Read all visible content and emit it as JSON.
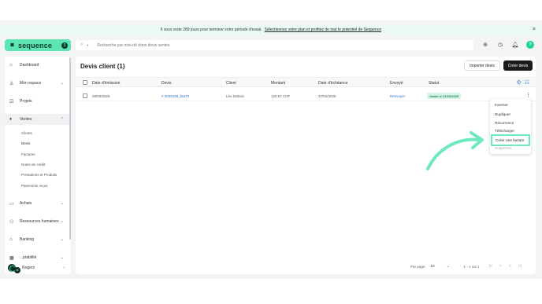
{
  "banner": {
    "text": "Il vous reste 289 jours pour terminer votre période d'essai.",
    "link": "Sélectionnez votre plan et profitez de tout le potentiel de Sequence",
    "close": "×"
  },
  "brand": {
    "name": "sequence",
    "badge": "$"
  },
  "search": {
    "placeholder": "Recherche par mot-clé dans devis ventes"
  },
  "sidebar": {
    "items": [
      {
        "label": "Dashboard",
        "icon": "home-icon"
      },
      {
        "label": "Mon espace",
        "icon": "person-icon"
      },
      {
        "label": "Projets",
        "icon": "checkbox-icon"
      },
      {
        "label": "Ventes",
        "icon": "rocket-icon"
      },
      {
        "label": "Achats",
        "icon": "bag-icon"
      },
      {
        "label": "Ressources humaines",
        "icon": "people-icon"
      },
      {
        "label": "Banking",
        "icon": "bank-icon"
      },
      {
        "label": "...ptabilité",
        "icon": "calculator-icon"
      }
    ],
    "sub_items": [
      "Clients",
      "Devis",
      "Factures",
      "Notes de crédit",
      "Prestations et Produits",
      "Paiements reçus"
    ]
  },
  "user": {
    "initials": "M",
    "name": "Rogers"
  },
  "main": {
    "title": "Devis client (1)",
    "import_label": "Importer devis",
    "create_label": "Créer devis"
  },
  "table": {
    "columns": [
      "Date d'émission",
      "Devis",
      "Client",
      "Montant",
      "Date d'échéance",
      "Envoyé",
      "Statut"
    ],
    "rows": [
      {
        "date": "28/03/2025",
        "devis": "# 2025328_faa73",
        "client": "Léo Dubois",
        "montant": "120.67 CHF",
        "echeance": "27/04/2025",
        "envoye": "Renvoyer",
        "statut": "Validé le 31/03/2025"
      }
    ]
  },
  "menu": {
    "items": [
      "Inverser",
      "Dupliquer",
      "Récurrence",
      "Télécharger",
      "Créer une facture",
      "Supprimer"
    ]
  },
  "pagination": {
    "per_page_label": "Par page:",
    "per_page_value": "10",
    "range": "1 - 1 sur 1",
    "first": "|<",
    "prev": "<",
    "next": ">",
    "last": ">|"
  },
  "colors": {
    "accent": "#5ee5b4",
    "highlight": "#6ee8bf",
    "link": "#2a6fc9",
    "status_bg": "#d7f5e6"
  }
}
